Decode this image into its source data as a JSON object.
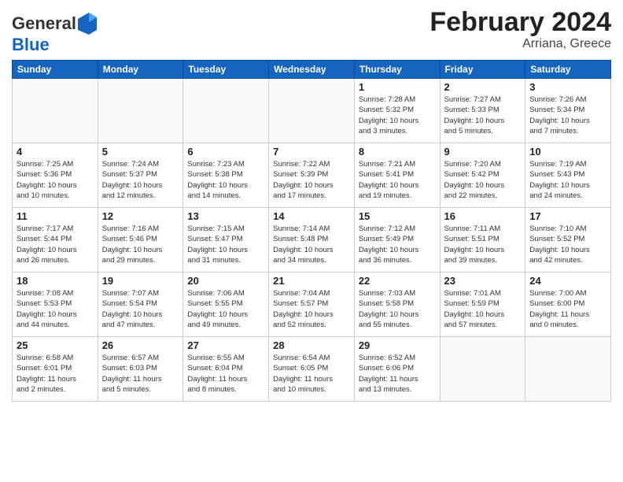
{
  "header": {
    "logo_general": "General",
    "logo_blue": "Blue",
    "title": "February 2024",
    "subtitle": "Arriana, Greece"
  },
  "days_of_week": [
    "Sunday",
    "Monday",
    "Tuesday",
    "Wednesday",
    "Thursday",
    "Friday",
    "Saturday"
  ],
  "weeks": [
    [
      {
        "day": "",
        "info": ""
      },
      {
        "day": "",
        "info": ""
      },
      {
        "day": "",
        "info": ""
      },
      {
        "day": "",
        "info": ""
      },
      {
        "day": "1",
        "info": "Sunrise: 7:28 AM\nSunset: 5:32 PM\nDaylight: 10 hours\nand 3 minutes."
      },
      {
        "day": "2",
        "info": "Sunrise: 7:27 AM\nSunset: 5:33 PM\nDaylight: 10 hours\nand 5 minutes."
      },
      {
        "day": "3",
        "info": "Sunrise: 7:26 AM\nSunset: 5:34 PM\nDaylight: 10 hours\nand 7 minutes."
      }
    ],
    [
      {
        "day": "4",
        "info": "Sunrise: 7:25 AM\nSunset: 5:36 PM\nDaylight: 10 hours\nand 10 minutes."
      },
      {
        "day": "5",
        "info": "Sunrise: 7:24 AM\nSunset: 5:37 PM\nDaylight: 10 hours\nand 12 minutes."
      },
      {
        "day": "6",
        "info": "Sunrise: 7:23 AM\nSunset: 5:38 PM\nDaylight: 10 hours\nand 14 minutes."
      },
      {
        "day": "7",
        "info": "Sunrise: 7:22 AM\nSunset: 5:39 PM\nDaylight: 10 hours\nand 17 minutes."
      },
      {
        "day": "8",
        "info": "Sunrise: 7:21 AM\nSunset: 5:41 PM\nDaylight: 10 hours\nand 19 minutes."
      },
      {
        "day": "9",
        "info": "Sunrise: 7:20 AM\nSunset: 5:42 PM\nDaylight: 10 hours\nand 22 minutes."
      },
      {
        "day": "10",
        "info": "Sunrise: 7:19 AM\nSunset: 5:43 PM\nDaylight: 10 hours\nand 24 minutes."
      }
    ],
    [
      {
        "day": "11",
        "info": "Sunrise: 7:17 AM\nSunset: 5:44 PM\nDaylight: 10 hours\nand 26 minutes."
      },
      {
        "day": "12",
        "info": "Sunrise: 7:16 AM\nSunset: 5:46 PM\nDaylight: 10 hours\nand 29 minutes."
      },
      {
        "day": "13",
        "info": "Sunrise: 7:15 AM\nSunset: 5:47 PM\nDaylight: 10 hours\nand 31 minutes."
      },
      {
        "day": "14",
        "info": "Sunrise: 7:14 AM\nSunset: 5:48 PM\nDaylight: 10 hours\nand 34 minutes."
      },
      {
        "day": "15",
        "info": "Sunrise: 7:12 AM\nSunset: 5:49 PM\nDaylight: 10 hours\nand 36 minutes."
      },
      {
        "day": "16",
        "info": "Sunrise: 7:11 AM\nSunset: 5:51 PM\nDaylight: 10 hours\nand 39 minutes."
      },
      {
        "day": "17",
        "info": "Sunrise: 7:10 AM\nSunset: 5:52 PM\nDaylight: 10 hours\nand 42 minutes."
      }
    ],
    [
      {
        "day": "18",
        "info": "Sunrise: 7:08 AM\nSunset: 5:53 PM\nDaylight: 10 hours\nand 44 minutes."
      },
      {
        "day": "19",
        "info": "Sunrise: 7:07 AM\nSunset: 5:54 PM\nDaylight: 10 hours\nand 47 minutes."
      },
      {
        "day": "20",
        "info": "Sunrise: 7:06 AM\nSunset: 5:55 PM\nDaylight: 10 hours\nand 49 minutes."
      },
      {
        "day": "21",
        "info": "Sunrise: 7:04 AM\nSunset: 5:57 PM\nDaylight: 10 hours\nand 52 minutes."
      },
      {
        "day": "22",
        "info": "Sunrise: 7:03 AM\nSunset: 5:58 PM\nDaylight: 10 hours\nand 55 minutes."
      },
      {
        "day": "23",
        "info": "Sunrise: 7:01 AM\nSunset: 5:59 PM\nDaylight: 10 hours\nand 57 minutes."
      },
      {
        "day": "24",
        "info": "Sunrise: 7:00 AM\nSunset: 6:00 PM\nDaylight: 11 hours\nand 0 minutes."
      }
    ],
    [
      {
        "day": "25",
        "info": "Sunrise: 6:58 AM\nSunset: 6:01 PM\nDaylight: 11 hours\nand 2 minutes."
      },
      {
        "day": "26",
        "info": "Sunrise: 6:57 AM\nSunset: 6:03 PM\nDaylight: 11 hours\nand 5 minutes."
      },
      {
        "day": "27",
        "info": "Sunrise: 6:55 AM\nSunset: 6:04 PM\nDaylight: 11 hours\nand 8 minutes."
      },
      {
        "day": "28",
        "info": "Sunrise: 6:54 AM\nSunset: 6:05 PM\nDaylight: 11 hours\nand 10 minutes."
      },
      {
        "day": "29",
        "info": "Sunrise: 6:52 AM\nSunset: 6:06 PM\nDaylight: 11 hours\nand 13 minutes."
      },
      {
        "day": "",
        "info": ""
      },
      {
        "day": "",
        "info": ""
      }
    ]
  ]
}
